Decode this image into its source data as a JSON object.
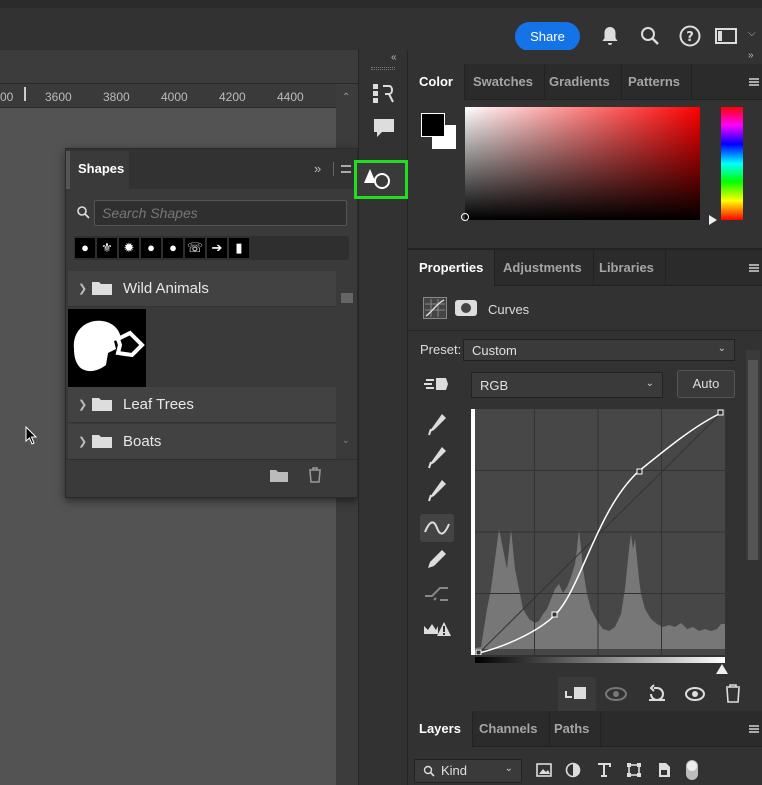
{
  "topbar": {
    "share_label": "Share",
    "icons": [
      "bell-icon",
      "search-icon",
      "help-icon",
      "workspace-icon"
    ]
  },
  "ruler": {
    "ticks": [
      "00",
      "3600",
      "3800",
      "4000",
      "4200",
      "4400"
    ]
  },
  "shapes_panel": {
    "tab_label": "Shapes",
    "search_placeholder": "Search Shapes",
    "recent_shapes": [
      "speech-bubble",
      "fleur-de-lis",
      "burst",
      "speech-bubble-2",
      "thought-bubble",
      "telephone",
      "arrow",
      "footprint"
    ],
    "groups": [
      {
        "label": "Wild Animals",
        "expanded": true
      },
      {
        "label": "Leaf Trees",
        "expanded": false
      },
      {
        "label": "Boats",
        "expanded": false
      }
    ]
  },
  "color_panel": {
    "tabs": [
      "Color",
      "Swatches",
      "Gradients",
      "Patterns"
    ],
    "foreground": "#000000",
    "background": "#ffffff"
  },
  "properties_panel": {
    "tabs": [
      "Properties",
      "Adjustments",
      "Libraries"
    ],
    "type_label": "Curves",
    "preset_label": "Preset:",
    "preset_value": "Custom",
    "channel_value": "RGB",
    "auto_label": "Auto"
  },
  "layers_panel": {
    "tabs": [
      "Layers",
      "Channels",
      "Paths"
    ],
    "filter_label": "Kind"
  },
  "colors": {
    "accent": "#1473e6",
    "highlight": "#22dd22"
  }
}
